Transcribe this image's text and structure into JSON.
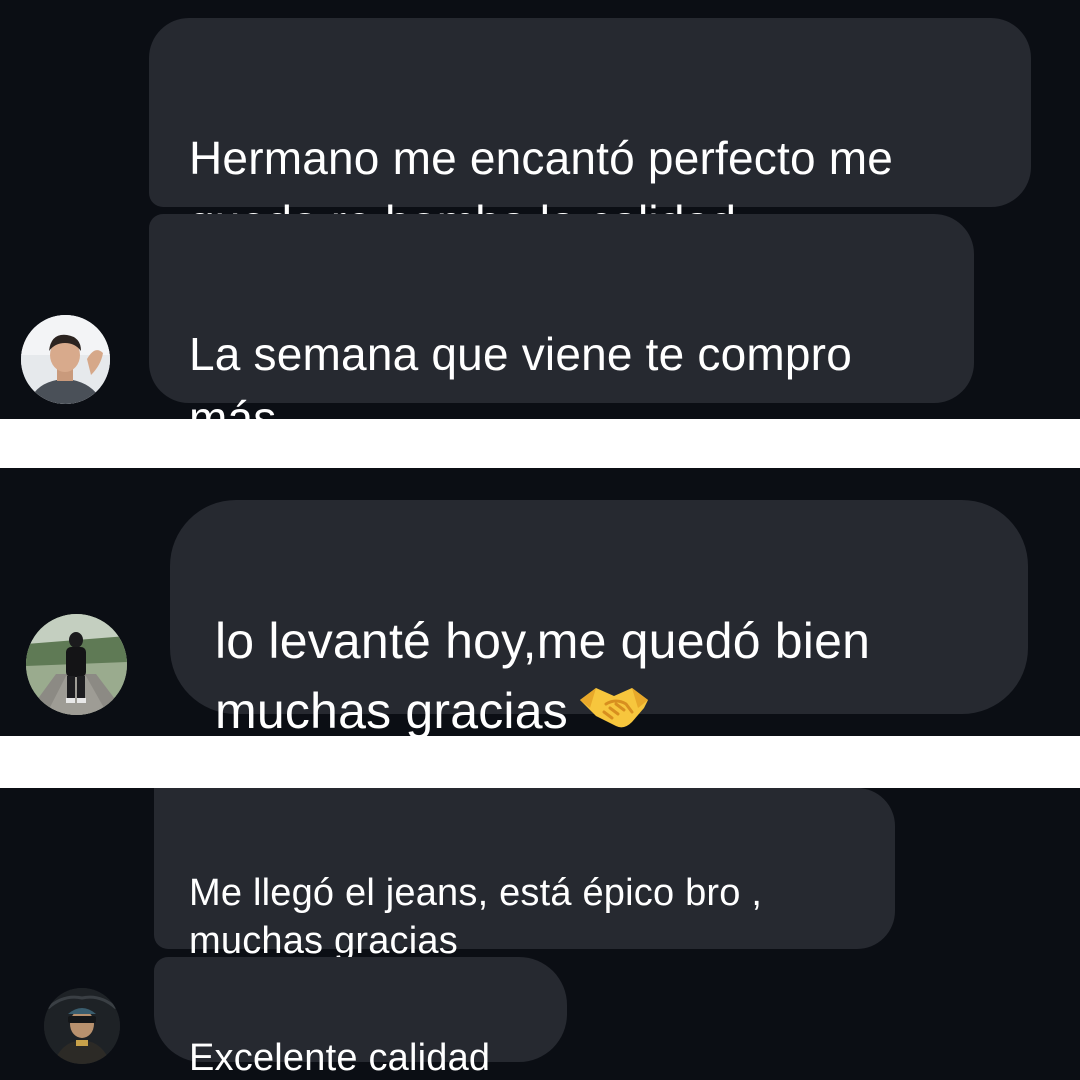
{
  "panels": [
    {
      "messages": [
        "Hermano me encantó perfecto me\nquedo re bomba la calidad",
        "La semana que viene te compro\nmás"
      ],
      "avatar_icon": "user-avatar-photo"
    },
    {
      "messages": [
        "lo levanté hoy,me quedó bien\nmuchas gracias"
      ],
      "emoji": "handshake-emoji",
      "avatar_icon": "user-avatar-photo"
    },
    {
      "messages": [
        "Me llegó el jeans, está épico bro ,\nmuchas gracias",
        "Excelente calidad"
      ],
      "avatar_icon": "user-avatar-photo"
    }
  ],
  "colors": {
    "background": "#0b0e14",
    "bubble": "#262930",
    "text": "#ffffff",
    "divider": "#ffffff"
  }
}
